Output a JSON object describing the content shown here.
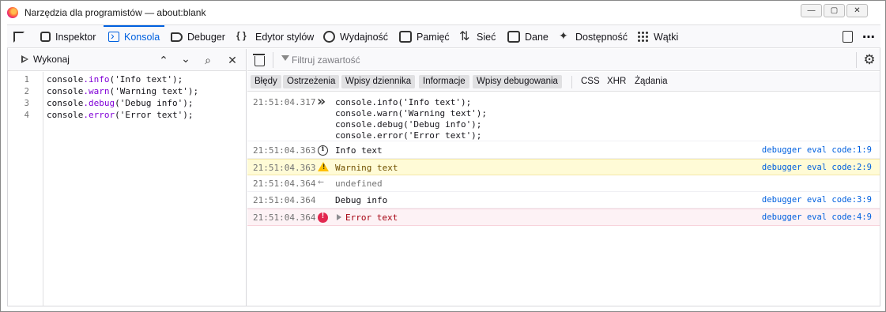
{
  "window": {
    "title": "Narzędzia dla programistów — about:blank",
    "controls": [
      "minimize",
      "maximize",
      "close"
    ]
  },
  "toolbar": {
    "tools": [
      {
        "label": "Inspektor",
        "icon": "inspector-icon"
      },
      {
        "label": "Konsola",
        "icon": "console-icon",
        "selected": true
      },
      {
        "label": "Debuger",
        "icon": "debugger-icon"
      },
      {
        "label": "Edytor stylów",
        "icon": "style-editor-icon"
      },
      {
        "label": "Wydajność",
        "icon": "performance-icon"
      },
      {
        "label": "Pamięć",
        "icon": "memory-icon"
      },
      {
        "label": "Sieć",
        "icon": "network-icon"
      },
      {
        "label": "Dane",
        "icon": "storage-icon"
      },
      {
        "label": "Dostępność",
        "icon": "accessibility-icon"
      },
      {
        "label": "Wątki",
        "icon": "threads-icon"
      }
    ]
  },
  "editor": {
    "run_label": "Wykonaj",
    "lines": [
      {
        "num": "1",
        "obj": "console",
        "method": ".info",
        "args": "('Info text');"
      },
      {
        "num": "2",
        "obj": "console",
        "method": ".warn",
        "args": "('Warning text');"
      },
      {
        "num": "3",
        "obj": "console",
        "method": ".debug",
        "args": "('Debug info');"
      },
      {
        "num": "4",
        "obj": "console",
        "method": ".error",
        "args": "('Error text');"
      }
    ]
  },
  "console": {
    "filter_placeholder": "Filtruj zawartość",
    "categories": [
      {
        "label": "Błędy",
        "on": true
      },
      {
        "label": "Ostrzeżenia",
        "on": true
      },
      {
        "label": "Wpisy dziennika",
        "on": true
      },
      {
        "label": "Informacje",
        "on": true
      },
      {
        "label": "Wpisy debugowania",
        "on": true
      },
      {
        "label": "CSS",
        "on": false
      },
      {
        "label": "XHR",
        "on": false
      },
      {
        "label": "Żądania",
        "on": false
      }
    ],
    "input_echo": {
      "timestamp": "21:51:04.317",
      "lines": [
        "console.info('Info text');",
        "console.warn('Warning text');",
        "console.debug('Debug info');",
        "console.error('Error text');"
      ]
    },
    "messages": [
      {
        "type": "info",
        "timestamp": "21:51:04.363",
        "text": "Info text",
        "location": "debugger eval code:1:9"
      },
      {
        "type": "warn",
        "timestamp": "21:51:04.363",
        "text": "Warning text",
        "location": "debugger eval code:2:9"
      },
      {
        "type": "result",
        "timestamp": "21:51:04.364",
        "text": "undefined",
        "location": ""
      },
      {
        "type": "debug",
        "timestamp": "21:51:04.364",
        "text": "Debug info",
        "location": "debugger eval code:3:9"
      },
      {
        "type": "error",
        "timestamp": "21:51:04.364",
        "text": "Error text",
        "location": "debugger eval code:4:9"
      }
    ]
  },
  "colors": {
    "accent": "#0060df",
    "warning_bg": "#fffbd6",
    "error_bg": "#fdf2f5",
    "error_text": "#a4000f",
    "warning_text": "#715100"
  }
}
